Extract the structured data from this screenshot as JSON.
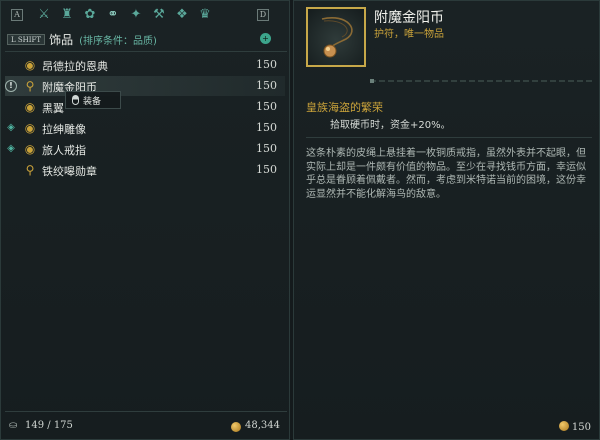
{
  "category_bar": {
    "left_key": "A",
    "right_key": "D",
    "icons": [
      {
        "name": "swords-icon",
        "glyph": "⚔"
      },
      {
        "name": "armor-icon",
        "glyph": "♜"
      },
      {
        "name": "bag-icon",
        "glyph": "✿"
      },
      {
        "name": "trinket-icon",
        "glyph": "⚭"
      },
      {
        "name": "jewelry-icon",
        "glyph": "✦"
      },
      {
        "name": "crafting-icon",
        "glyph": "⚒"
      },
      {
        "name": "misc-icon",
        "glyph": "❖"
      },
      {
        "name": "crown-icon",
        "glyph": "♛"
      }
    ],
    "accent": "#5aa89a"
  },
  "list": {
    "shift_tag": "L SHIFT",
    "category_title": "饰品",
    "sort_label": "(排序条件：品质)",
    "sort_button": "+",
    "items": [
      {
        "name": "昂德拉的恩典",
        "price": "150",
        "badge": "",
        "icon": "ring-icon"
      },
      {
        "name": "附魔金阳币",
        "price": "150",
        "badge": "!",
        "icon": "amulet-icon"
      },
      {
        "name": "黑翼",
        "price": "150",
        "badge": "",
        "icon": "ring-icon"
      },
      {
        "name": "拉绅雕像",
        "price": "150",
        "badge": "◈",
        "icon": "ring-icon"
      },
      {
        "name": "旅人戒指",
        "price": "150",
        "badge": "◈",
        "icon": "ring-icon"
      },
      {
        "name": "铁绞嗥勋章",
        "price": "150",
        "badge": "",
        "icon": "amulet-icon"
      }
    ],
    "tooltip_action": "装备"
  },
  "footer": {
    "capacity": "149 / 175",
    "gold": "48,344"
  },
  "detail": {
    "title": "附魔金阳币",
    "subtitle": "护符，唯一物品",
    "effect_title": "皇族海盗的繁荣",
    "effect_text": "拾取硬币时，资金+20%。",
    "lore": "这条朴素的皮绳上悬挂着一枚铜质戒指，虽然外表并不起眼，但实际上却是一件颇有价值的物品。至少在寻找钱币方面，幸运似乎总是眷顾着佩戴者。然而，考虑到米特诺当前的困境，这份幸运显然并不能化解海鸟的敌意。",
    "price": "150",
    "gold_color": "#c9a23a"
  }
}
